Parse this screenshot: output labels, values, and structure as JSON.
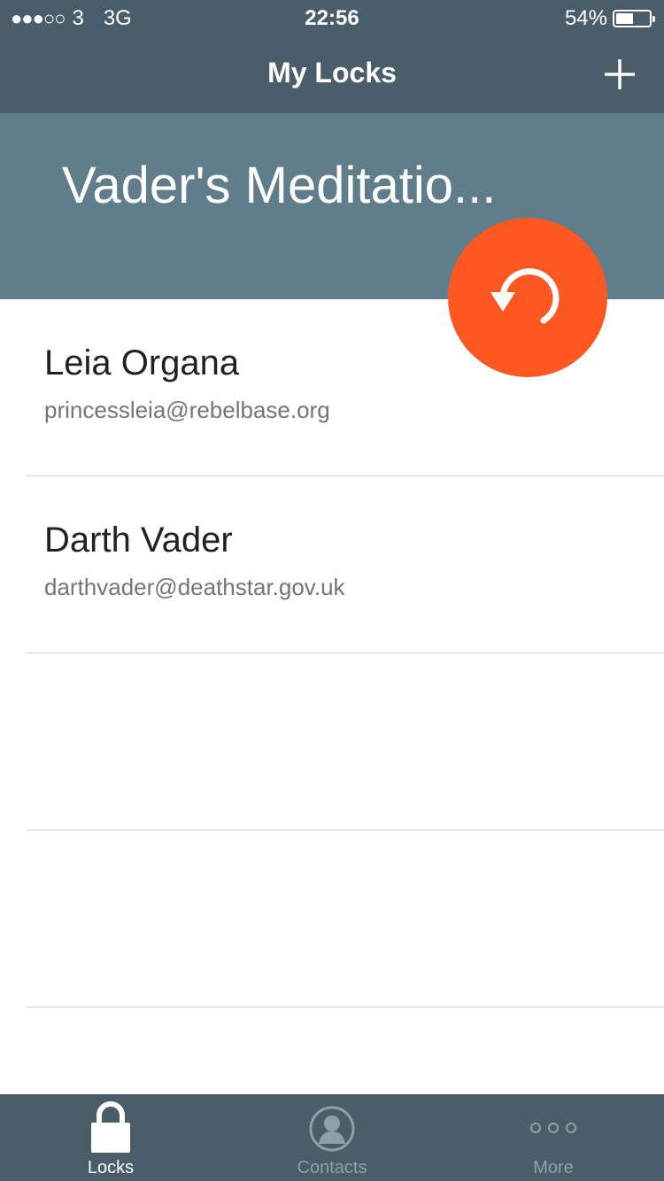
{
  "status_bar": {
    "signal_dots": "●●●○○",
    "carrier": "3",
    "network": "3G",
    "time": "22:56",
    "battery_text": "54%",
    "battery_level": 0.54
  },
  "nav": {
    "title": "My Locks",
    "add_icon": "plus-icon"
  },
  "header": {
    "lock_name": "Vader's Meditatio..."
  },
  "fab": {
    "icon": "refresh-icon",
    "color": "#ff5722"
  },
  "contacts": [
    {
      "name": "Leia Organa",
      "email": "princessleia@rebelbase.org"
    },
    {
      "name": "Darth Vader",
      "email": "darthvader@deathstar.gov.uk"
    }
  ],
  "tabs": [
    {
      "label": "Locks",
      "icon": "lock-icon",
      "active": true
    },
    {
      "label": "Contacts",
      "icon": "contacts-icon",
      "active": false
    },
    {
      "label": "More",
      "icon": "more-icon",
      "active": false
    }
  ],
  "colors": {
    "bar": "#4a5e69",
    "header": "#5f7d8a",
    "accent": "#ff5722"
  }
}
